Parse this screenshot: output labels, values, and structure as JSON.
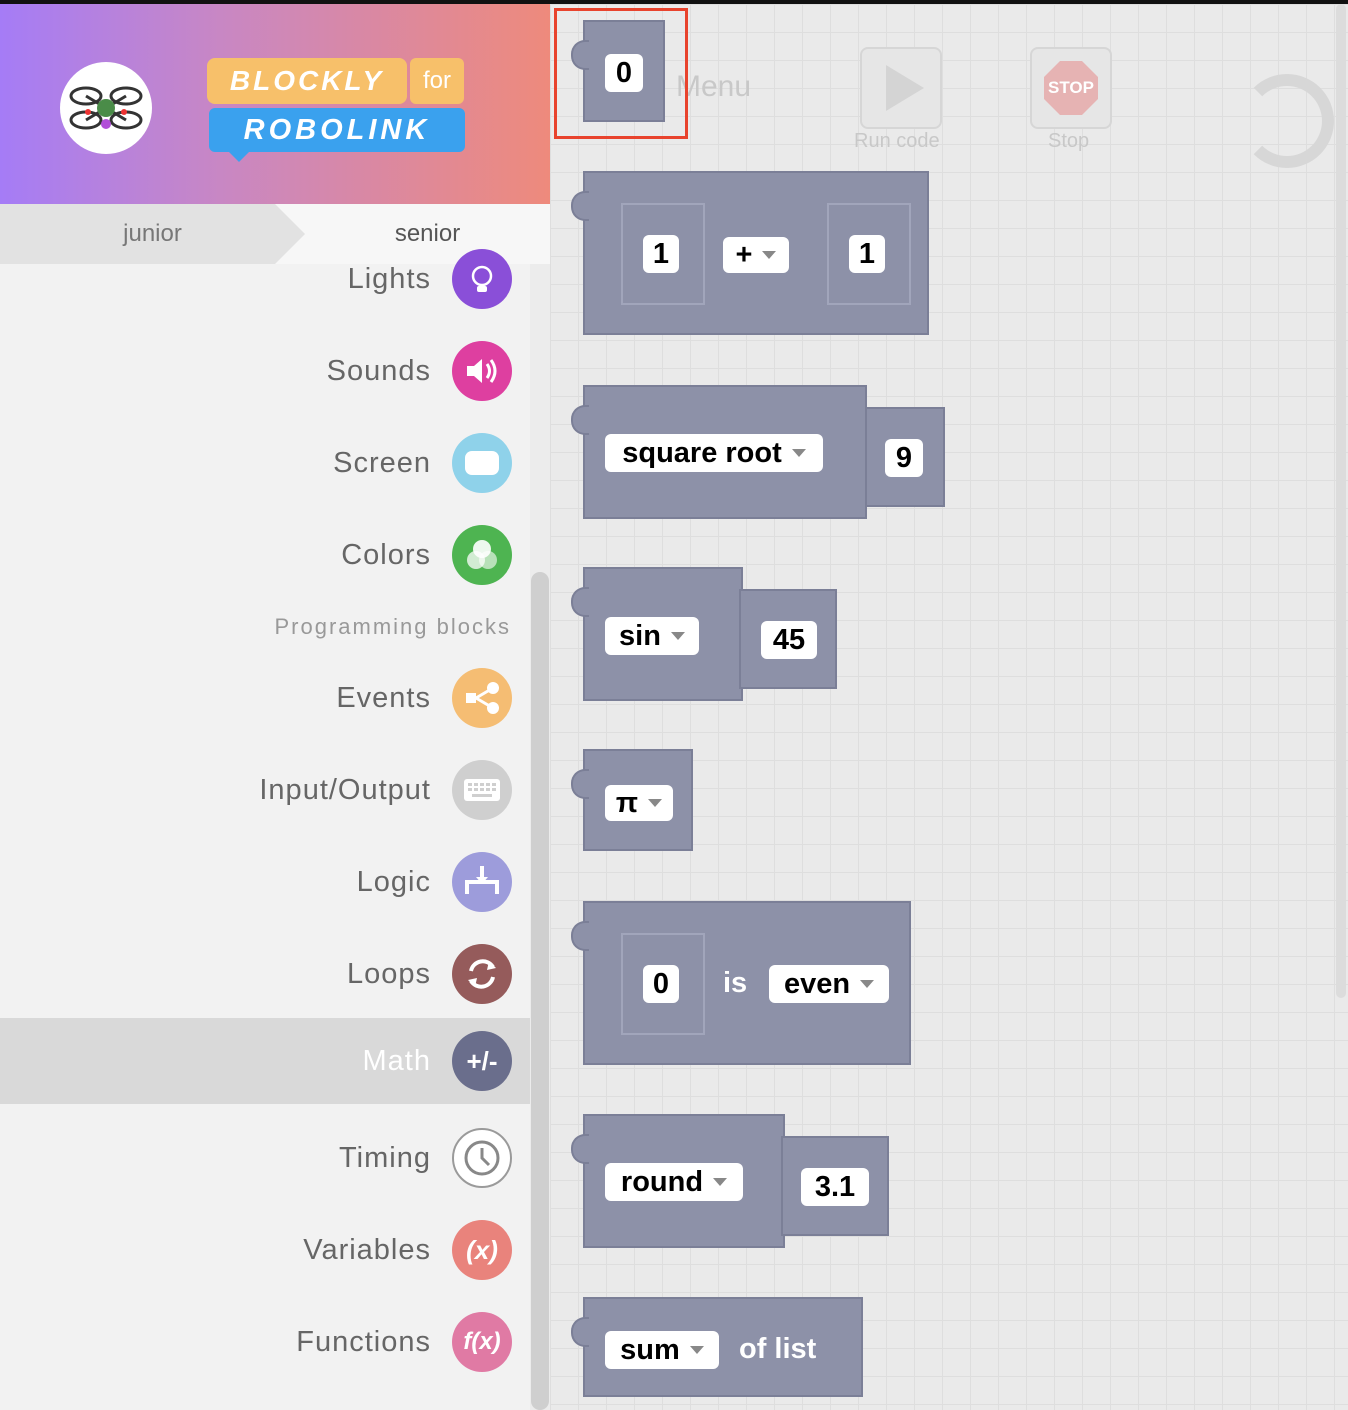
{
  "app": {
    "logo_line1": "BLOCKLY",
    "logo_for": "for",
    "logo_line2": "ROBOLINK"
  },
  "tabs": {
    "junior": "junior",
    "senior": "senior"
  },
  "categories": [
    {
      "label": "Lights",
      "icon": "lightbulb-icon",
      "color": "#8a4fd8"
    },
    {
      "label": "Sounds",
      "icon": "speaker-icon",
      "color": "#de3fa0"
    },
    {
      "label": "Screen",
      "icon": "screen-icon",
      "color": "#8fd2ea"
    },
    {
      "label": "Colors",
      "icon": "color-circles-icon",
      "color": "#4eb451"
    },
    {
      "label": "Events",
      "icon": "share-nodes-icon",
      "color": "#f5bd73"
    },
    {
      "label": "Input/Output",
      "icon": "keyboard-icon",
      "color": "#cfcfcf"
    },
    {
      "label": "Logic",
      "icon": "fork-icon",
      "color": "#9d9cdb"
    },
    {
      "label": "Loops",
      "icon": "loop-arrows-icon",
      "color": "#955b5b"
    },
    {
      "label": "Math",
      "icon": "plus-minus-icon",
      "color": "#6a6e8c",
      "selected": true
    },
    {
      "label": "Timing",
      "icon": "clock-icon",
      "color": "#ffffff"
    },
    {
      "label": "Variables",
      "icon": "variable-icon",
      "color": "#e9837c"
    },
    {
      "label": "Functions",
      "icon": "function-icon",
      "color": "#e07aa4"
    }
  ],
  "section_label": "Programming blocks",
  "icon_glyphs": {
    "plus_minus": "+/-",
    "variable": "(x)",
    "function": "f(x)"
  },
  "toolbar": {
    "menu": "Menu",
    "run_label": "Run code",
    "stop_label": "Stop",
    "stop_sign": "STOP"
  },
  "blocks": {
    "number": "0",
    "arith_left": "1",
    "arith_op": "+",
    "arith_right": "1",
    "single_op": "square root",
    "single_value": "9",
    "trig_op": "sin",
    "trig_value": "45",
    "constant": "π",
    "prop_value": "0",
    "prop_is": "is",
    "prop_check": "even",
    "round_op": "round",
    "round_value": "3.1",
    "list_op": "sum",
    "list_text": "of list"
  }
}
